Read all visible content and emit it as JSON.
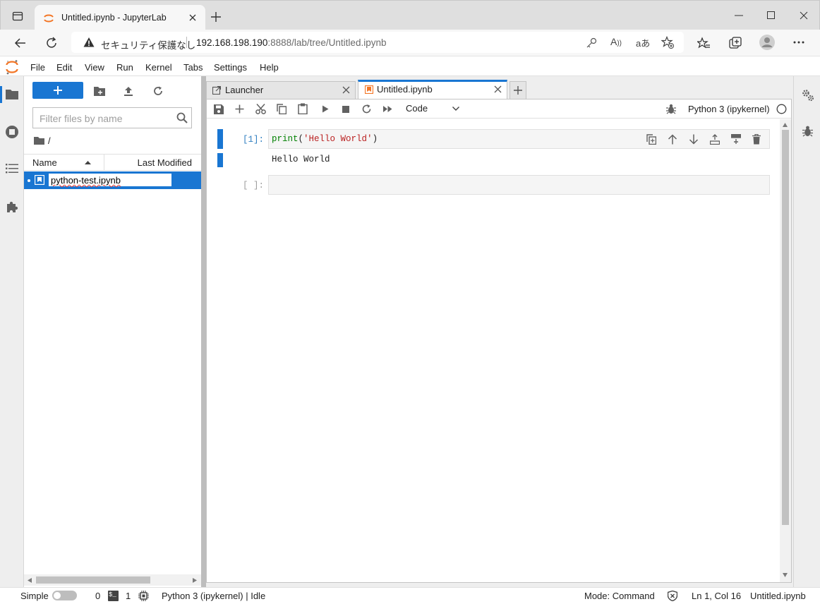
{
  "browser": {
    "tab_title": "Untitled.ipynb - JupyterLab",
    "security_label": "セキュリティ保護なし",
    "url_host": "192.168.198.190",
    "url_rest": ":8888/lab/tree/Untitled.ipynb"
  },
  "menu": [
    "File",
    "Edit",
    "View",
    "Run",
    "Kernel",
    "Tabs",
    "Settings",
    "Help"
  ],
  "filebrowser": {
    "filter_placeholder": "Filter files by name",
    "path": "/",
    "col_name": "Name",
    "col_modified": "Last Modified",
    "files": [
      {
        "name": "python-test.ipynb",
        "selected": true
      }
    ]
  },
  "tabs": [
    {
      "label": "Launcher",
      "active": false
    },
    {
      "label": "Untitled.ipynb",
      "active": true
    }
  ],
  "toolbar": {
    "cell_type": "Code",
    "kernel_name": "Python 3 (ipykernel)"
  },
  "cells": [
    {
      "prompt": "[1]:",
      "code_fn": "print",
      "code_open": "(",
      "code_str": "'Hello World'",
      "code_close": ")",
      "output": "Hello World"
    },
    {
      "prompt": "[ ]:",
      "code": ""
    }
  ],
  "status": {
    "mode_label": "Simple",
    "terminals": "0",
    "kernels": "1",
    "kernel_status": "Python 3 (ipykernel) | Idle",
    "mode": "Mode: Command",
    "position": "Ln 1, Col 16",
    "filename": "Untitled.ipynb"
  },
  "colors": {
    "accent": "#1976d2",
    "jupyter_orange": "#f37626",
    "selection": "#1976d2",
    "code_green": "#008000",
    "code_string": "#ba2121",
    "prompt_blue": "#307fc1"
  }
}
